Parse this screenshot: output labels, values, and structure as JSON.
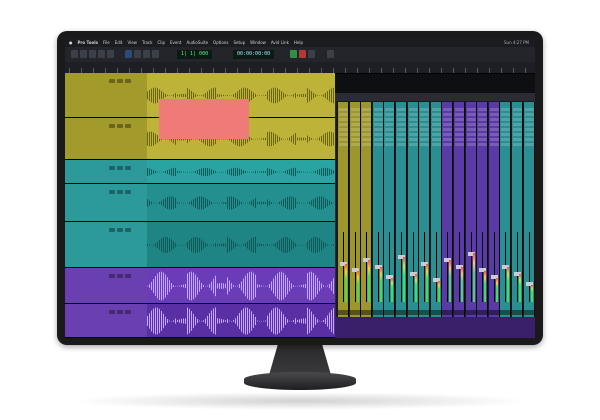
{
  "app": {
    "name": "Pro Tools",
    "menus": [
      "File",
      "Edit",
      "View",
      "Track",
      "Clip",
      "Event",
      "AudioSuite",
      "Options",
      "Setup",
      "Window",
      "Avid Link",
      "Help"
    ],
    "clock": "Sun 4:27 PM"
  },
  "toolbar": {
    "main_counter": "1| 1| 000",
    "sub_counter": "00:00:00:00"
  },
  "tracks": [
    {
      "id": "t1",
      "color": "#a39a2c",
      "lane": "#bdb338"
    },
    {
      "id": "t2",
      "color": "#a39a2c",
      "lane": "#bdb338"
    },
    {
      "id": "t3",
      "color": "#2c9a9a",
      "lane": "#2aa3a3"
    },
    {
      "id": "t4",
      "color": "#2c9a9a",
      "lane": "#248f8f"
    },
    {
      "id": "t5",
      "color": "#2c9a9a",
      "lane": "#1f8484"
    },
    {
      "id": "t6",
      "color": "#6a3fb0",
      "lane": "#6b3cb8"
    },
    {
      "id": "t7",
      "color": "#6a3fb0",
      "lane": "#5a2fa4"
    }
  ],
  "colors": {
    "yellow": "#bdb338",
    "teal": "#2aa3a3",
    "purple": "#6b3cb8",
    "clip_red": "#f07a78",
    "meter_green": "#3ee05a"
  },
  "mixer": {
    "strips": [
      {
        "color": "#9d962c",
        "level": 0.55
      },
      {
        "color": "#9d962c",
        "level": 0.45
      },
      {
        "color": "#9d962c",
        "level": 0.6
      },
      {
        "color": "#2a8f92",
        "level": 0.5
      },
      {
        "color": "#2a8f92",
        "level": 0.35
      },
      {
        "color": "#2a8f92",
        "level": 0.65
      },
      {
        "color": "#2a8f92",
        "level": 0.4
      },
      {
        "color": "#2a8f92",
        "level": 0.55
      },
      {
        "color": "#2a8f92",
        "level": 0.3
      },
      {
        "color": "#5a3aa6",
        "level": 0.6
      },
      {
        "color": "#5a3aa6",
        "level": 0.5
      },
      {
        "color": "#5a3aa6",
        "level": 0.7
      },
      {
        "color": "#5a3aa6",
        "level": 0.45
      },
      {
        "color": "#5a3aa6",
        "level": 0.35
      },
      {
        "color": "#2a8f92",
        "level": 0.5
      },
      {
        "color": "#2a8f92",
        "level": 0.4
      },
      {
        "color": "#2a8f92",
        "level": 0.25
      }
    ]
  }
}
